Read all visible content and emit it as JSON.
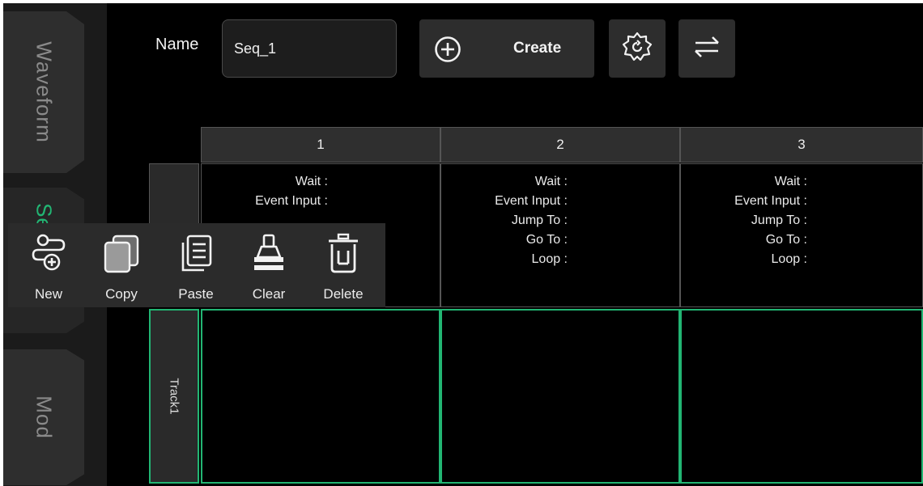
{
  "tabs": [
    {
      "label": "Waveform",
      "active": false
    },
    {
      "label": "Se",
      "active": true
    },
    {
      "label": "Mod",
      "active": false
    }
  ],
  "header": {
    "name_label": "Name",
    "name_value": "Seq_1",
    "create_label": "Create",
    "icons": [
      "add-circle-icon",
      "settings-icon",
      "swap-icon"
    ]
  },
  "grid": {
    "columns": [
      "1",
      "2",
      "3"
    ],
    "col1_lines": [
      "Wait :",
      "Event Input :"
    ],
    "col2_lines": [
      "Wait :",
      "Event Input :",
      "Jump To :",
      "Go To :",
      "Loop :"
    ],
    "col3_lines": [
      "Wait :",
      "Event Input :",
      "Jump To :",
      "Go To :",
      "Loop :"
    ],
    "track_label": "Track1"
  },
  "toolbar": {
    "new": "New",
    "copy": "Copy",
    "paste": "Paste",
    "clear": "Clear",
    "delete": "Delete"
  },
  "colors": {
    "accent": "#22b573",
    "background": "#000000",
    "panel": "#2d2d2d"
  }
}
